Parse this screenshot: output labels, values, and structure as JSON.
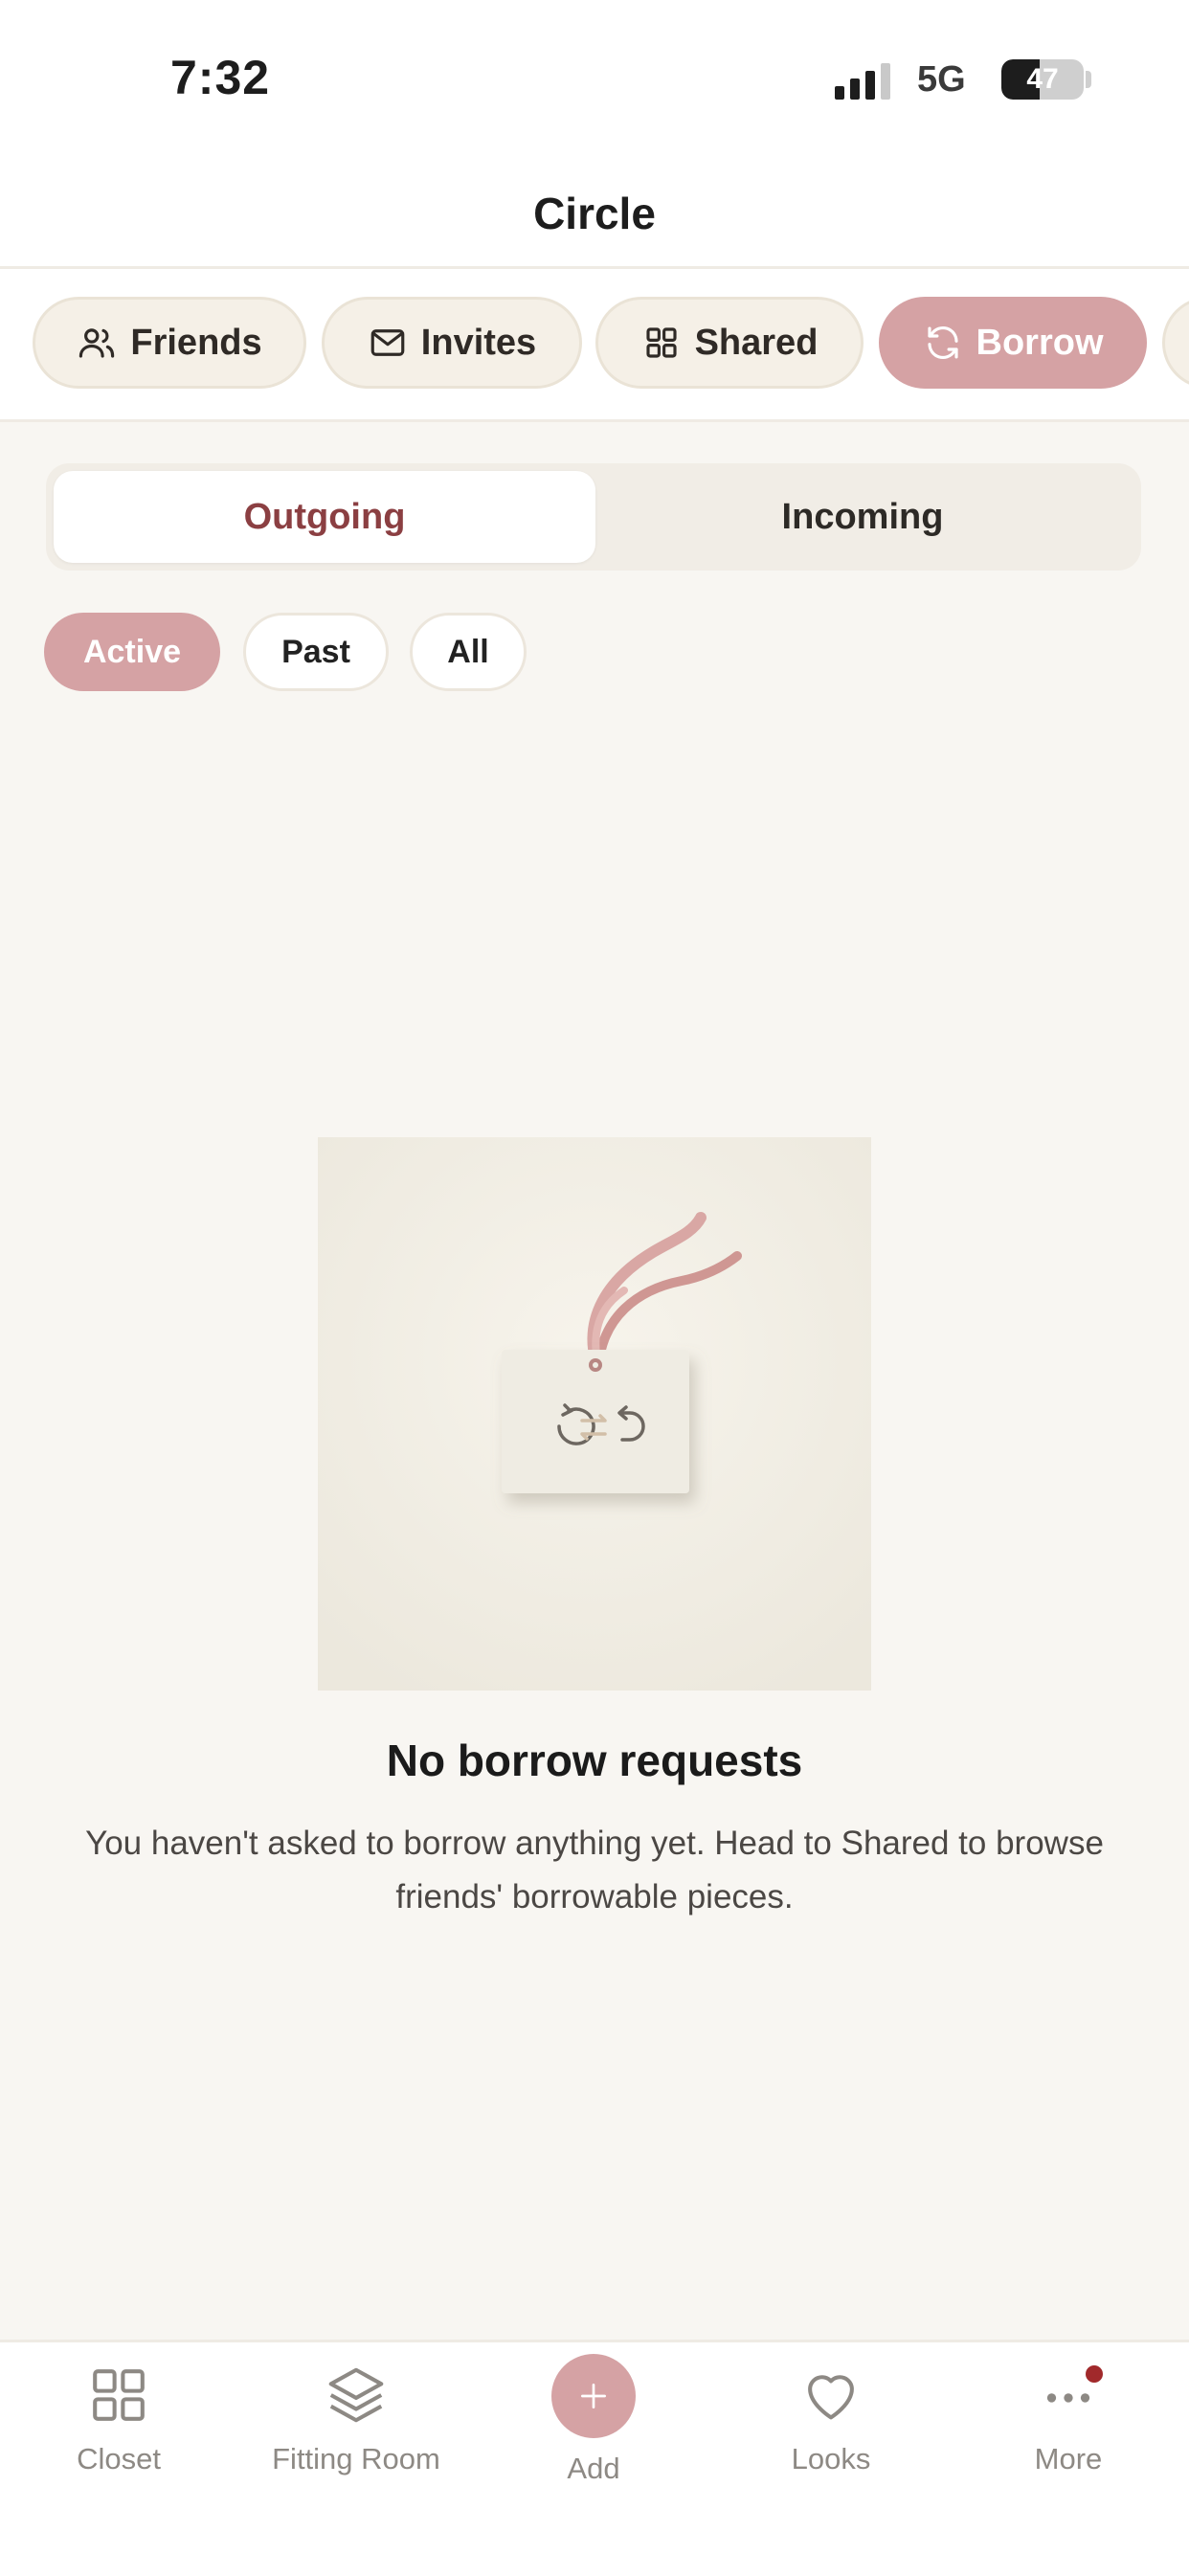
{
  "status_bar": {
    "time": "7:32",
    "network": "5G",
    "battery": "47",
    "battery_level": 0.47
  },
  "header": {
    "title": "Circle"
  },
  "tabs": [
    {
      "label": "Friends",
      "icon": "people-icon"
    },
    {
      "label": "Invites",
      "icon": "envelope-icon"
    },
    {
      "label": "Shared",
      "icon": "grid-icon"
    },
    {
      "label": "Borrow",
      "icon": "refresh-icon",
      "active": true
    }
  ],
  "segments": {
    "outgoing": "Outgoing",
    "incoming": "Incoming",
    "selected": "Outgoing"
  },
  "filters": [
    {
      "label": "Active",
      "active": true
    },
    {
      "label": "Past"
    },
    {
      "label": "All"
    }
  ],
  "empty_state": {
    "title": "No borrow requests",
    "body": "You haven't asked to borrow anything yet. Head to Shared to browse friends' borrowable pieces."
  },
  "tabbar": {
    "closet": "Closet",
    "fitting_room": "Fitting Room",
    "add": "Add",
    "looks": "Looks",
    "more": "More"
  },
  "colors": {
    "accent": "#D5A2A4",
    "background": "#F8F6F2",
    "selected_text": "#8B3F42",
    "notification_dot": "#A1292B"
  }
}
